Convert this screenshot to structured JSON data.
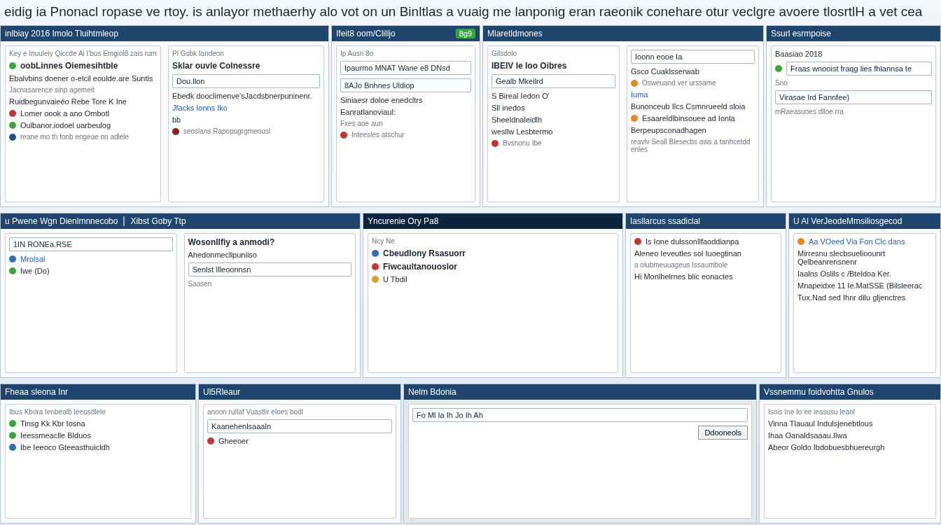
{
  "headline": "eidig ia Pnonacl ropase ve rtoy. is anlayor methaerhy alo vot on un Binltlas a vuaig me lanponig eran raeonik conehare otur veclgre avoere tlosrtlH a vet cea",
  "desk_rows": [
    {
      "windows": [
        {
          "title": "inlbiay 2016 Imolo Tluihtmleop",
          "panes": [
            {
              "rows": [
                {
                  "kind": "note",
                  "text": "Key e Inuuleiy Qiccde Ai I'bus Emgiol8 zais rum"
                },
                {
                  "kind": "heading",
                  "text": "oobLinnes Oiemesihtble",
                  "color": "#3aa53a"
                },
                {
                  "kind": "text",
                  "text": "Ebalvbins doener o-elcil eoulde.are Suntis"
                },
                {
                  "kind": "note",
                  "text": "Jacnasarence sinp agemeit"
                },
                {
                  "kind": "text",
                  "text": "Ruidbegunvaieéo Rebe Tore K Ine"
                },
                {
                  "kind": "text",
                  "text": "Lomer oook a ano Ombotl",
                  "color": "#c83232"
                },
                {
                  "kind": "text",
                  "text": "Oulbanor.iodoel uarbeulog",
                  "color": "#3aa53a"
                },
                {
                  "kind": "note",
                  "text": "reane mo th fonb engeae on adlele",
                  "color": "#1f4f86"
                }
              ]
            },
            {
              "rows": [
                {
                  "kind": "note",
                  "text": "Pl Gsbk Iandeon"
                },
                {
                  "kind": "heading",
                  "text": "Sklar ouvle Colnessre"
                },
                {
                  "kind": "field",
                  "text": "Dou.llon"
                },
                {
                  "kind": "text",
                  "text": "Ebedk dooclimenve'sJacdsbnerpuninenr."
                },
                {
                  "kind": "link",
                  "text": "Jfacks Ionns Iko"
                },
                {
                  "kind": "text",
                  "text": "bb"
                },
                {
                  "kind": "note",
                  "text": "seoslans Rapopugrgmeousl",
                  "color": "#8a1f1f"
                }
              ]
            }
          ]
        },
        {
          "title": "Ifeit8 oom/Clilljo",
          "badge": "8g9",
          "panes": [
            {
              "rows": [
                {
                  "kind": "note",
                  "text": "Ip Ausn 8o"
                },
                {
                  "kind": "field",
                  "text": "Ipaurmo MNAT Wane e8 DNsd"
                },
                {
                  "kind": "field",
                  "text": "8AJo Bnhnes Uldiop"
                },
                {
                  "kind": "text",
                  "text": "Siniaesr doloe enedcltrs"
                },
                {
                  "kind": "text",
                  "text": "Eanratlanoviaul:"
                },
                {
                  "kind": "note",
                  "text": "Fxes aoe aun"
                },
                {
                  "kind": "note",
                  "text": "Inteesles atschur",
                  "color": "#c83232"
                }
              ]
            }
          ]
        },
        {
          "title": "Mlaretldmones",
          "panes": [
            {
              "rows": [
                {
                  "kind": "note",
                  "text": "Gilsdolo"
                },
                {
                  "kind": "heading",
                  "text": "IBEIV Ie Ioo Oibres"
                },
                {
                  "kind": "field",
                  "text": "Gealb Mkeilrd"
                },
                {
                  "kind": "text",
                  "text": "S Bireal Iedon O'"
                },
                {
                  "kind": "text",
                  "text": "Sll inedos"
                },
                {
                  "kind": "text",
                  "text": "Sheeldnaleidlh"
                },
                {
                  "kind": "text",
                  "text": "wesllw Lesbtermo"
                },
                {
                  "kind": "note",
                  "text": "Bvsnonu Ibe",
                  "color": "#c83232"
                }
              ]
            },
            {
              "rows": [
                {
                  "kind": "field",
                  "text": "Ioonn eooe Ia"
                },
                {
                  "kind": "text",
                  "text": "Gsco Cuaklsserwab"
                },
                {
                  "kind": "note",
                  "text": "Osweuand ver urssame",
                  "color": "#e08a2a"
                },
                {
                  "kind": "link",
                  "text": "Iuma"
                },
                {
                  "kind": "text",
                  "text": "Bunonceub Ilcs Csmnrueeld sloia"
                },
                {
                  "kind": "text",
                  "text": "Esaareldlbinsouee ad Ionla",
                  "color": "#e08a2a"
                },
                {
                  "kind": "text",
                  "text": "Berpeupsconadhagen"
                },
                {
                  "kind": "note",
                  "text": "reavlv Seall Blesecbs aws a tanhcetdd enles"
                }
              ]
            }
          ]
        },
        {
          "title": "Ssurl esrmpoise",
          "panes": [
            {
              "rows": [
                {
                  "kind": "text",
                  "text": "Baasiao 2018"
                },
                {
                  "kind": "field",
                  "text": "Fraas wnooist fraqg lies fhlannsa te",
                  "color": "#3aa53a"
                },
                {
                  "kind": "note",
                  "text": "Sno"
                },
                {
                  "kind": "field",
                  "text": "Virasae Ird Fannfee)"
                },
                {
                  "kind": "note",
                  "text": "mRaeasuoes dlloe rra"
                }
              ]
            }
          ]
        }
      ]
    },
    {
      "windows": [
        {
          "title": "u Pwene Wgn Dienlmnnecobo",
          "tab": "Xibst Goby Ttp",
          "panes": [
            {
              "rows": [
                {
                  "kind": "field",
                  "text": "1IN RONEa.RSE"
                },
                {
                  "kind": "link",
                  "text": "Mrolsal",
                  "color": "#2f6fb3"
                },
                {
                  "kind": "text",
                  "text": "Iwe (Do)",
                  "color": "#3aa53a"
                }
              ]
            },
            {
              "rows": [
                {
                  "kind": "heading",
                  "text": "Wosonllfiy a anmodi?"
                },
                {
                  "kind": "text",
                  "text": "Ahedonmecllpuniiso"
                },
                {
                  "kind": "field",
                  "text": "Senlst Illeoonnsn"
                },
                {
                  "kind": "note",
                  "text": "Saasen"
                }
              ]
            }
          ]
        },
        {
          "title": "Yncurenie Ory Pa8",
          "dark": true,
          "panes": [
            {
              "rows": [
                {
                  "kind": "note",
                  "text": "Ncy Ne"
                },
                {
                  "kind": "heading",
                  "text": "Cbeudlony Rsasuorr",
                  "color": "#2f6fb3"
                },
                {
                  "kind": "heading",
                  "text": "Fiwcaultanouoslor",
                  "color": "#c83232"
                },
                {
                  "kind": "text",
                  "text": "U Tbdil",
                  "color": "#d0a030"
                }
              ]
            }
          ]
        },
        {
          "title": "Iasllarcus ssadiclal",
          "panes": [
            {
              "rows": [
                {
                  "kind": "text",
                  "text": "Is Ione dulssonllfaoddianpa",
                  "color": "#c83232"
                },
                {
                  "kind": "text",
                  "text": "Aleneo Ieveutles sol Iuoegtinan"
                },
                {
                  "kind": "note",
                  "text": "a olubmeuuageus Issaumbole"
                },
                {
                  "kind": "text",
                  "text": "Hi Monlhelrnes blic eonactes"
                }
              ]
            }
          ]
        },
        {
          "title": "U Al VerJeodeMmsiliosgecod",
          "panes": [
            {
              "rows": [
                {
                  "kind": "link",
                  "text": "Aa VOeed Via Fon Clc dans",
                  "color": "#e08a2a"
                },
                {
                  "kind": "text",
                  "text": "Mirresnu slecbsuelioounrt Qelbeanrensnenr"
                },
                {
                  "kind": "text",
                  "text": "Iaalns Oslils c /Bteldoa Ker."
                },
                {
                  "kind": "text",
                  "text": "Mnapeidxe 11 Ie.MatSSE (Bilsleerac"
                },
                {
                  "kind": "text",
                  "text": "Tux.Nad sed Ihnr dilu gljenctres"
                }
              ]
            }
          ]
        }
      ]
    },
    {
      "windows": [
        {
          "title": "Fheaa sleona Inr",
          "panes": [
            {
              "rows": [
                {
                  "kind": "note",
                  "text": "Ibus Kbora Ienbealb Ieeusdlele"
                },
                {
                  "kind": "text",
                  "text": "Tinsg Kk Kbr Iosna",
                  "color": "#3aa53a"
                },
                {
                  "kind": "text",
                  "text": "Ieessmeaclle Blduos",
                  "color": "#3aa53a"
                },
                {
                  "kind": "text",
                  "text": "Ibe Ieeoco Gteeasthuicldh",
                  "color": "#2f6fb3"
                }
              ]
            }
          ]
        },
        {
          "title": "Ul5Rleaur",
          "panes": [
            {
              "rows": [
                {
                  "kind": "note",
                  "text": "anoon ruIlaf Vuastlir eloes bodl"
                },
                {
                  "kind": "field",
                  "text": "Kaanehenlsaaaln"
                },
                {
                  "kind": "text",
                  "text": "Gheeoer",
                  "color": "#c83232"
                }
              ]
            }
          ]
        },
        {
          "title": "Nelm Bdonia",
          "grey": true,
          "panes": [
            {
              "rows": [
                {
                  "kind": "field",
                  "text": "Fo Ml Ia Ih Jo Ih Ah"
                },
                {
                  "kind": "button",
                  "text": "Ddooneols"
                }
              ]
            }
          ]
        },
        {
          "title": "Vssnemmu foidvohtta Gnulos",
          "panes": [
            {
              "rows": [
                {
                  "kind": "note",
                  "text": "Isois Ine Io ee ieasusu Ieaol"
                },
                {
                  "kind": "text",
                  "text": "Vinna Tlauaul Indulsjenebtlous"
                },
                {
                  "kind": "text",
                  "text": "Ihaa Oanaldsaaau.Ilwa"
                },
                {
                  "kind": "text",
                  "text": "Abeor Goldo Ibdobuesbhuereurgh"
                }
              ]
            }
          ]
        }
      ]
    }
  ]
}
